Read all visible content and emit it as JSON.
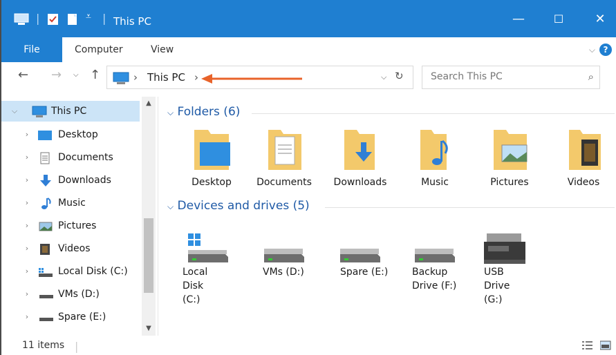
{
  "window": {
    "title": "This PC",
    "minimize": "—",
    "maximize": "☐",
    "close": "✕"
  },
  "ribbon": {
    "tabs": [
      "File",
      "Computer",
      "View"
    ],
    "collapse": "⌵",
    "help": "?"
  },
  "address": {
    "breadcrumb_sep": "›",
    "location": "This PC",
    "trailing_sep": "›",
    "search_placeholder": "Search This PC"
  },
  "sidebar": {
    "items": [
      {
        "label": "This PC",
        "icon": "computer-icon",
        "expanded": true,
        "selected": true
      },
      {
        "label": "Desktop",
        "icon": "desktop-icon"
      },
      {
        "label": "Documents",
        "icon": "documents-icon"
      },
      {
        "label": "Downloads",
        "icon": "downloads-icon"
      },
      {
        "label": "Music",
        "icon": "music-icon"
      },
      {
        "label": "Pictures",
        "icon": "pictures-icon"
      },
      {
        "label": "Videos",
        "icon": "videos-icon"
      },
      {
        "label": "Local Disk (C:)",
        "icon": "local-disk-icon"
      },
      {
        "label": "VMs (D:)",
        "icon": "drive-icon"
      },
      {
        "label": "Spare (E:)",
        "icon": "drive-icon"
      }
    ]
  },
  "content": {
    "folders_header": "Folders (6)",
    "folders": [
      {
        "label": "Desktop",
        "icon": "desktop-folder-icon"
      },
      {
        "label": "Documents",
        "icon": "documents-folder-icon"
      },
      {
        "label": "Downloads",
        "icon": "downloads-folder-icon"
      },
      {
        "label": "Music",
        "icon": "music-folder-icon"
      },
      {
        "label": "Pictures",
        "icon": "pictures-folder-icon"
      },
      {
        "label": "Videos",
        "icon": "videos-folder-icon"
      }
    ],
    "drives_header": "Devices and drives (5)",
    "drives": [
      {
        "line1": "Local Disk",
        "line2": "(C:)",
        "icon": "windows-drive-icon"
      },
      {
        "line1": "VMs (D:)",
        "line2": "",
        "icon": "hard-drive-icon"
      },
      {
        "line1": "Spare (E:)",
        "line2": "",
        "icon": "hard-drive-icon"
      },
      {
        "line1": "Backup",
        "line2": "Drive (F:)",
        "icon": "hard-drive-icon"
      },
      {
        "line1": "USB Drive",
        "line2": "(G:)",
        "icon": "usb-drive-icon"
      }
    ]
  },
  "status": {
    "item_count": "11 items"
  },
  "colors": {
    "accent": "#1f7fd1",
    "annotation_arrow": "#e8632a",
    "selection": "#cce4f7"
  }
}
